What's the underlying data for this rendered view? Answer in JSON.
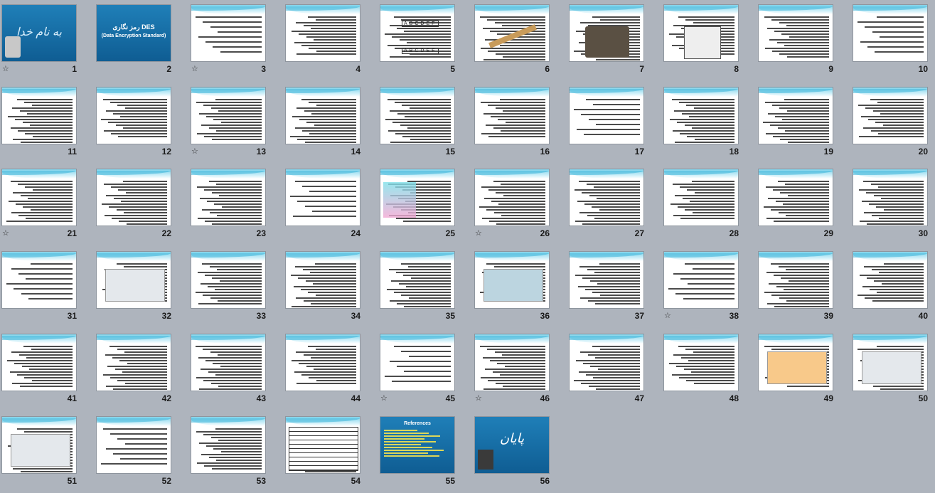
{
  "slides": [
    {
      "n": "1",
      "star": true
    },
    {
      "n": "2",
      "star": false
    },
    {
      "n": "3",
      "star": true
    },
    {
      "n": "4",
      "star": false
    },
    {
      "n": "5",
      "star": false
    },
    {
      "n": "6",
      "star": false
    },
    {
      "n": "7",
      "star": false
    },
    {
      "n": "8",
      "star": false
    },
    {
      "n": "9",
      "star": false
    },
    {
      "n": "10",
      "star": false
    },
    {
      "n": "11",
      "star": false
    },
    {
      "n": "12",
      "star": false
    },
    {
      "n": "13",
      "star": true
    },
    {
      "n": "14",
      "star": false
    },
    {
      "n": "15",
      "star": false
    },
    {
      "n": "16",
      "star": false
    },
    {
      "n": "17",
      "star": false
    },
    {
      "n": "18",
      "star": false
    },
    {
      "n": "19",
      "star": false
    },
    {
      "n": "20",
      "star": false
    },
    {
      "n": "21",
      "star": true
    },
    {
      "n": "22",
      "star": false
    },
    {
      "n": "23",
      "star": false
    },
    {
      "n": "24",
      "star": false
    },
    {
      "n": "25",
      "star": false
    },
    {
      "n": "26",
      "star": true
    },
    {
      "n": "27",
      "star": false
    },
    {
      "n": "28",
      "star": false
    },
    {
      "n": "29",
      "star": false
    },
    {
      "n": "30",
      "star": false
    },
    {
      "n": "31",
      "star": false
    },
    {
      "n": "32",
      "star": false
    },
    {
      "n": "33",
      "star": false
    },
    {
      "n": "34",
      "star": false
    },
    {
      "n": "35",
      "star": false
    },
    {
      "n": "36",
      "star": false
    },
    {
      "n": "37",
      "star": false
    },
    {
      "n": "38",
      "star": true
    },
    {
      "n": "39",
      "star": false
    },
    {
      "n": "40",
      "star": false
    },
    {
      "n": "41",
      "star": false
    },
    {
      "n": "42",
      "star": false
    },
    {
      "n": "43",
      "star": false
    },
    {
      "n": "44",
      "star": false
    },
    {
      "n": "45",
      "star": true
    },
    {
      "n": "46",
      "star": true
    },
    {
      "n": "47",
      "star": false
    },
    {
      "n": "48",
      "star": false
    },
    {
      "n": "49",
      "star": false
    },
    {
      "n": "50",
      "star": false
    },
    {
      "n": "51",
      "star": false
    },
    {
      "n": "52",
      "star": false
    },
    {
      "n": "53",
      "star": false
    },
    {
      "n": "54",
      "star": false
    },
    {
      "n": "55",
      "star": false
    },
    {
      "n": "56",
      "star": false
    }
  ],
  "star_glyph": "☆",
  "slide1": {
    "title": "به نام خدا"
  },
  "slide2": {
    "title": "رمز نگاری DES",
    "subtitle": "(Data Encryption  Standard)"
  },
  "slide5": {
    "letters": "ABCDEF"
  },
  "slide25": {
    "text_label": "Hash",
    "heading": "Symmetric"
  },
  "slide30": {
    "heading": "Symmetric"
  },
  "slide33": {
    "heading": "Asymmetric"
  },
  "slide34": {
    "lines": [
      "Elliptic Curve Cryptography",
      "Digital Signature",
      "Diffie-Hellman",
      "Signal Discrete log Cryptography",
      "Quantum Cryptography"
    ]
  },
  "slide53": {
    "heading": "Hash Algorithm"
  },
  "slide55": {
    "heading": "References"
  },
  "slide56": {
    "title": "پایان"
  },
  "colors": {
    "background": "#aeb4bd",
    "accent_wave": "#39b3d8",
    "title_blue": "#123a6b"
  }
}
